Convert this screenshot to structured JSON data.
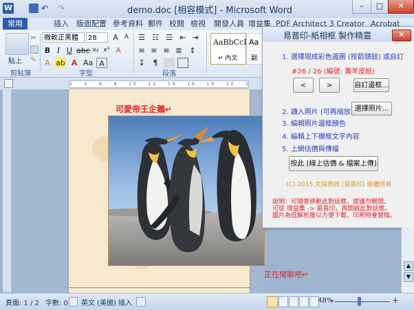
{
  "window": {
    "title": "demo.doc [相容模式] - Microsoft Word",
    "minimize": "–",
    "maximize": "□",
    "close": "✕"
  },
  "tabs": {
    "file": "常用",
    "items": [
      "插入",
      "版面配置",
      "參考資料",
      "郵件",
      "校閱",
      "檢視",
      "開發人員",
      "增益集",
      "PDF Architect 3 Creator",
      "Acrobat"
    ]
  },
  "ribbon": {
    "paste_label": "貼上",
    "font_name": "微軟正黑體",
    "font_size": "28",
    "style_sample": "AaBbCcI",
    "style_name": "↵ 內文",
    "style2_sample": "Aa",
    "style2_name": "副",
    "groups": {
      "clipboard": "剪貼簿",
      "font": "字型",
      "paragraph": "段落"
    }
  },
  "ruler": {
    "ticks": "2 · 4 · 6 · 8 · 10 · 12 · 14 · 16 · 18 · 20 · 22 · 24 · 26 · 28 · 30 · 32 · 34 · 36 ·"
  },
  "document": {
    "title": "可愛帝王企鵝↵",
    "caption": "正在閒聊吧↵"
  },
  "dialog": {
    "title": "易普印-紙相框 製作精靈",
    "close": "✕",
    "step1": "1. 選擇現成彩色邊圖 (按箭頭鈕) 或自訂",
    "frame_info": "#26 / 26 (編號: 黃羊皮紙)",
    "prev": "<",
    "next": ">",
    "custom_btn": "自訂邊框...",
    "step2": "2. 讀入照片 (可再縮放)",
    "select_photo_btn": "選擇照片...",
    "step3": "3. 編輯照片邊框顏色",
    "step4": "4. 編輯上下欄框文字內容",
    "step5": "5. 上網估價與傳檔",
    "submit_btn": "按此 [線上估價 & 檔案上傳]",
    "copyright": "(C) 2015 文採資訊 (易普印) 版權所有",
    "note1": "說明：可隨意移動此對話框，建議勿關閉。",
    "note2": "可從 增益集 -> 易普印，再開啟此對話框。",
    "note3": "圖片為低解析度以方便下載，印刷時會替換。"
  },
  "status": {
    "page": "頁面: 1 / 2",
    "words": "字數: 0",
    "language": "英文 (美國)",
    "insert": "插入",
    "zoom": "48%",
    "zoom_minus": "–",
    "zoom_plus": "+"
  },
  "colors": {
    "accent": "#2b5ca8",
    "dialog_text": "#2a3fbf",
    "red_text": "#e0262a",
    "page_bg": "#f7e9cd"
  }
}
